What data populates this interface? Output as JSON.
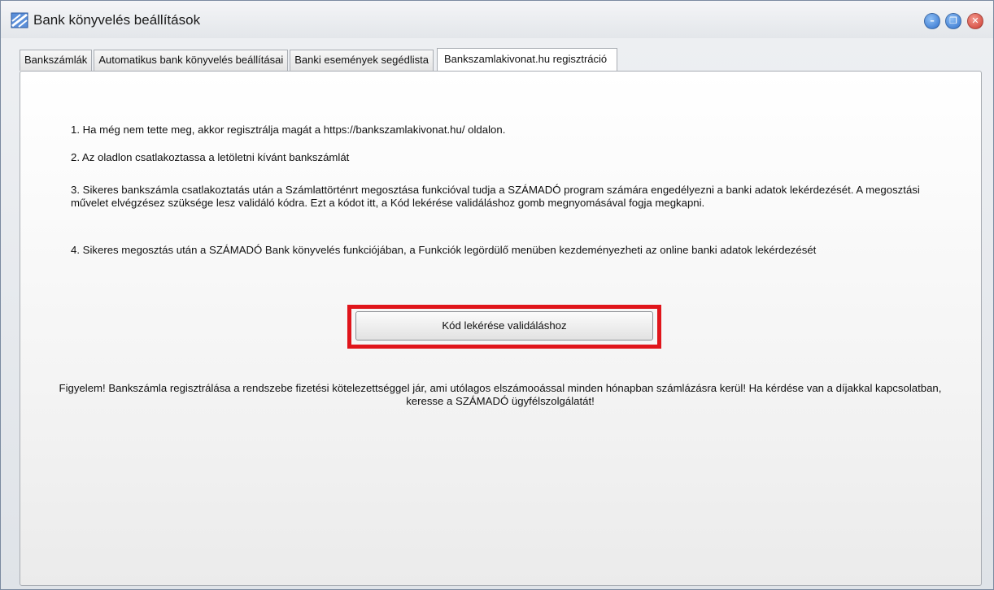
{
  "window": {
    "title": "Bank könyvelés beállítások",
    "icon": "bank-settings-icon",
    "controls": {
      "minimize_icon": "minimize-icon",
      "restore_icon": "restore-icon",
      "close_icon": "close-icon"
    }
  },
  "tabs": [
    {
      "label": "Bankszámlák"
    },
    {
      "label": "Automatikus bank könyvelés beállításai"
    },
    {
      "label": "Banki események segédlista"
    },
    {
      "label": "Bankszamlakivonat.hu regisztráció",
      "active": true
    }
  ],
  "content": {
    "steps": [
      "1. Ha még nem tette meg, akkor regisztrálja magát a https://bankszamlakivonat.hu/ oldalon.",
      "2. Az oladlon csatlakoztassa a letöletni kívánt bankszámlát",
      "3. Sikeres bankszámla csatlakoztatás után a Számlattörténrt megosztása funkcióval  tudja a SZÁMADÓ program számára engedélyezni a  banki adatok lekérdezését. A megosztási művelet elvégzésez szüksége lesz validáló kódra. Ezt a kódot itt, a Kód lekérése validáláshoz gomb megnyomásával fogja megkapni.",
      "4. Sikeres megosztás után a SZÁMADÓ Bank könyvelés  funkciójában, a Funkciók legördülő menüben kezdeményezheti az online banki adatok lekérdezését"
    ],
    "button_label": "Kód lekérése validáláshoz",
    "warning": "Figyelem! Bankszámla regisztrálása a rendszebe fizetési kötelezettséggel jár, ami utólagos elszámooással minden hónapban számlázásra kerül! Ha kérdése van a díjakkal kapcsolatban, keresse a SZÁMADÓ ügyfélszolgálatát!"
  },
  "colors": {
    "highlight": "#e0151b",
    "minimize": "#2f6fcc",
    "close": "#cc3a2f"
  }
}
